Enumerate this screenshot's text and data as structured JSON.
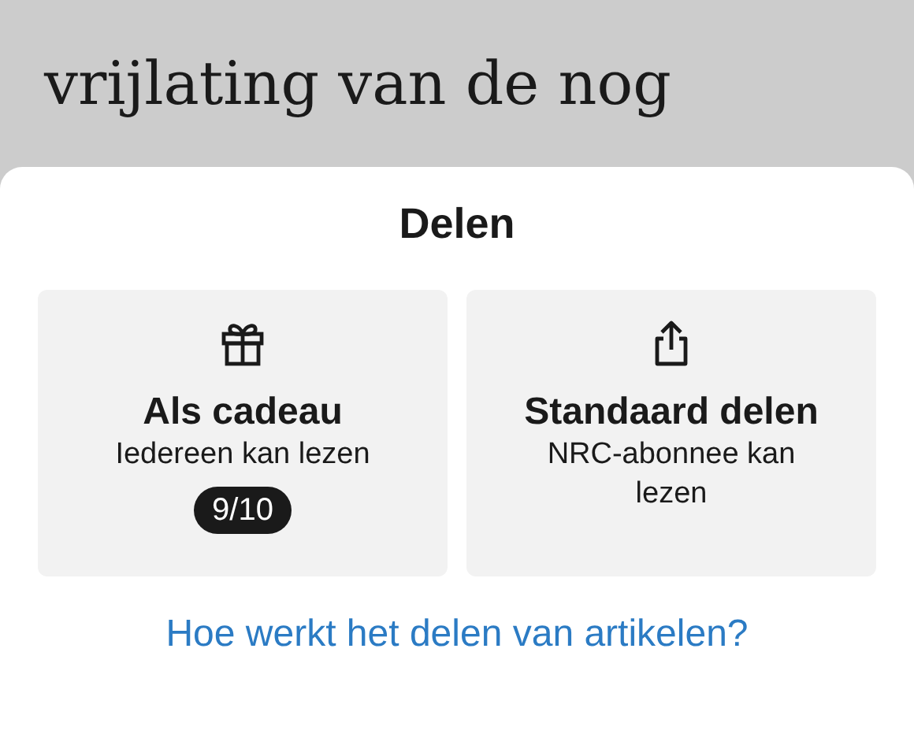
{
  "article": {
    "line": "vrijlating van de nog"
  },
  "share_sheet": {
    "title": "Delen",
    "options": [
      {
        "kind": "gift",
        "title": "Als cadeau",
        "subtitle": "Iedereen kan lezen",
        "badge": "9/10"
      },
      {
        "kind": "share",
        "title": "Standaard delen",
        "subtitle": "NRC-abonnee kan lezen"
      }
    ],
    "help_link": "Hoe werkt het delen van artikelen?"
  }
}
